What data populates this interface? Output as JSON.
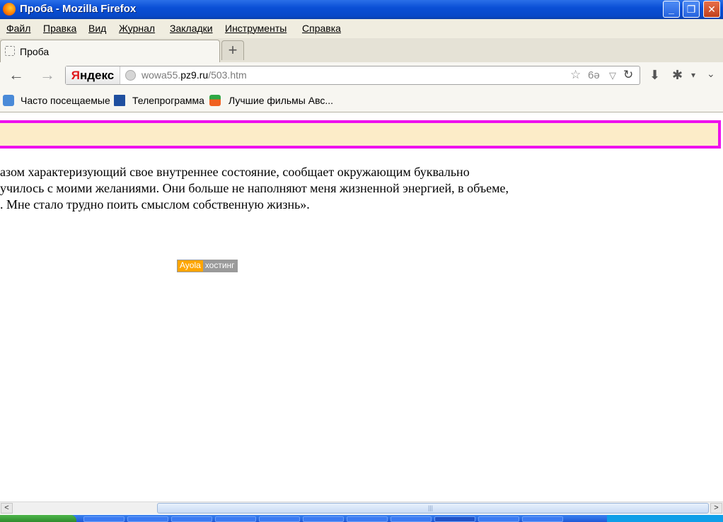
{
  "window": {
    "title": "Проба - Mozilla Firefox",
    "buttons": {
      "minimize": "_",
      "restore": "❐",
      "close": "✕"
    }
  },
  "menu": {
    "items": [
      "Файл",
      "Правка",
      "Вид",
      "Журнал",
      "Закладки",
      "Инструменты",
      "Справка"
    ]
  },
  "tabs": {
    "active_title": "Проба",
    "new_tab_symbol": "+"
  },
  "nav": {
    "back_icon": "←",
    "forward_icon": "→",
    "search_engine": {
      "first_letter": "Я",
      "rest": "ндекс"
    },
    "url": {
      "prefix": "wowa55.",
      "host": "pz9.ru",
      "path": "/503.htm"
    },
    "star_icon": "☆",
    "reader_icon": "6ə",
    "dropdown_icon": "▽",
    "reload_icon": "↻",
    "download_icon": "⬇",
    "addon_icon": "✱",
    "menu_caret_icon": "▾",
    "more_icon": "⌄"
  },
  "bookmarks": {
    "items": [
      "Часто посещаемые",
      "Телепрограмма",
      "Лучшие фильмы Авс..."
    ]
  },
  "content": {
    "lines": [
      "азом характеризующий свое внутреннее состояние, сообщает окружающим буквально",
      "училось с моими желаниями. Они больше не наполняют меня жизненной энергией, в объеме,",
      ". Мне стало трудно поить смыслом собственную жизнь»."
    ],
    "hosting_badge": {
      "brand": "Ayola",
      "text": "хостинг"
    }
  },
  "scrollbar": {
    "left_arrow": "<",
    "right_arrow": ">",
    "grip": "|||"
  },
  "colors": {
    "title_bar": "#0a4fd6",
    "highlight_border": "#ee10ee",
    "highlight_fill": "#fcecc8",
    "brand_orange": "#ffa500"
  }
}
